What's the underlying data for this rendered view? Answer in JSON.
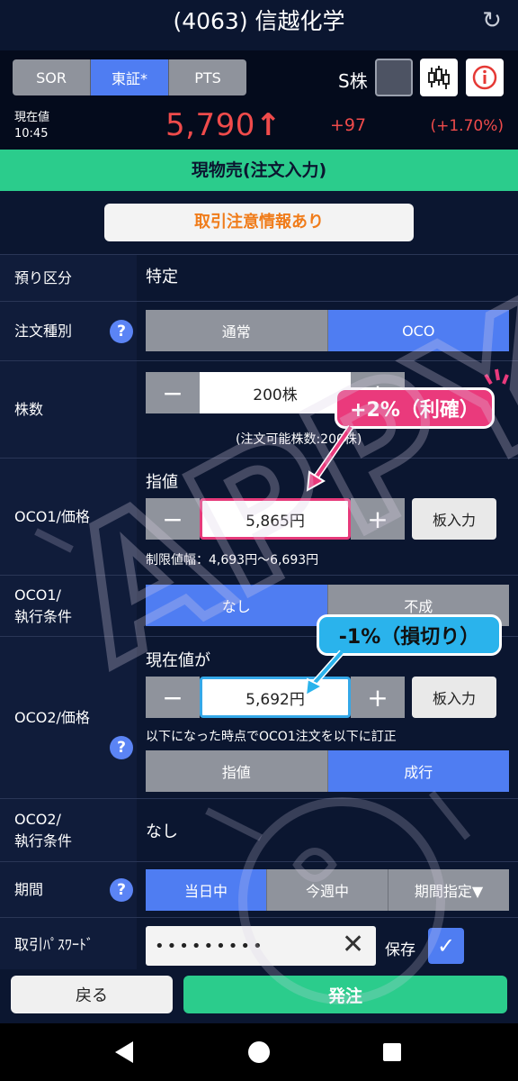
{
  "title": "(4063) 信越化学",
  "market_tabs": [
    "SOR",
    "東証*",
    "PTS"
  ],
  "active_market": 1,
  "s_kabu_label": "S株",
  "icons": {
    "refresh": "refresh-icon",
    "chart": "candlestick-icon",
    "info": "info-icon"
  },
  "quote": {
    "label": "現在値",
    "time": "10:45",
    "price": "5,790",
    "arrow": "↑",
    "change": "+97",
    "change_pct": "(+1.70%)",
    "color": "#f04b4b"
  },
  "section_title": "現物売(注文入力)",
  "warning_button": "取引注意情報あり",
  "form": {
    "account": {
      "label": "預り区分",
      "value": "特定"
    },
    "order_type": {
      "label": "注文種別",
      "options": [
        "通常",
        "OCO"
      ],
      "selected": 1
    },
    "shares": {
      "label": "株数",
      "value": "200株",
      "available": "(注文可能株数:200株)"
    },
    "oco1_price": {
      "label": "OCO1/価格",
      "type_label": "指値",
      "value": "5,865円",
      "plus_label": "板入力",
      "limit_range": "制限値幅：4,693円〜6,693円"
    },
    "oco1_cond": {
      "label1": "OCO1/",
      "label2": "執行条件",
      "options": [
        "なし",
        "不成"
      ],
      "selected": 0
    },
    "oco2_price": {
      "label": "OCO2/価格",
      "trigger_label": "現在値が",
      "value": "5,692円",
      "plus_label": "板入力",
      "note": "以下になった時点でOCO1注文を以下に訂正",
      "options": [
        "指値",
        "成行"
      ],
      "selected": 1
    },
    "oco2_cond": {
      "label1": "OCO2/",
      "label2": "執行条件",
      "value": "なし"
    },
    "period": {
      "label": "期間",
      "options": [
        "当日中",
        "今週中",
        "期間指定▼"
      ],
      "selected": 0
    },
    "password": {
      "label": "取引ﾊﾟｽﾜｰﾄﾞ",
      "value": "•••••••••",
      "save_label": "保存"
    }
  },
  "callouts": {
    "take_profit": "+2%（利確）",
    "stop_loss": "-1%（損切り）"
  },
  "buttons": {
    "back": "戻る",
    "order": "発注"
  },
  "watermark_text": "APPY"
}
